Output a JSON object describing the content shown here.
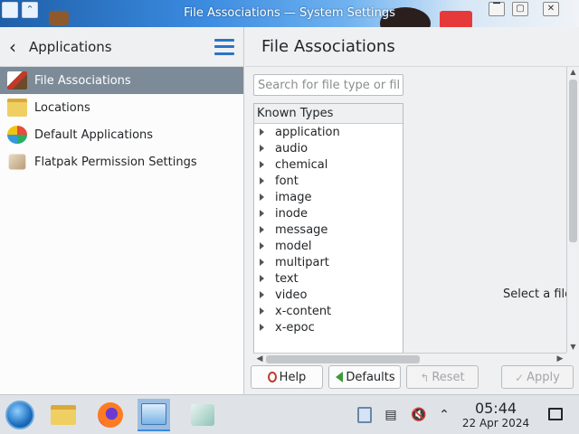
{
  "window": {
    "title": "File Associations — System Settings",
    "buttons": {
      "keep_above": "⌃",
      "minimize": "▔",
      "maximize": "▢",
      "close": "✕"
    }
  },
  "sidebar": {
    "title": "Applications",
    "back_icon": "chevron-left-icon",
    "menu_icon": "hamburger-icon",
    "items": [
      {
        "label": "File Associations",
        "icon": "file-associations-icon",
        "active": true
      },
      {
        "label": "Locations",
        "icon": "folder-icon",
        "active": false
      },
      {
        "label": "Default Applications",
        "icon": "default-apps-icon",
        "active": false
      },
      {
        "label": "Flatpak Permission Settings",
        "icon": "flatpak-icon",
        "active": false
      }
    ]
  },
  "main": {
    "title": "File Associations",
    "search": {
      "placeholder": "Search for file type or fil...",
      "value": ""
    },
    "tree": {
      "header": "Known Types",
      "items": [
        "application",
        "audio",
        "chemical",
        "font",
        "image",
        "inode",
        "message",
        "model",
        "multipart",
        "text",
        "video",
        "x-content",
        "x-epoc"
      ]
    },
    "hint": "Select a file"
  },
  "footer": {
    "help": "Help",
    "defaults": "Defaults",
    "reset": "Reset",
    "apply": "Apply"
  },
  "taskbar": {
    "apps": [
      "start-menu-icon",
      "file-manager-icon",
      "firefox-icon",
      "system-settings-icon",
      "software-store-icon"
    ],
    "tray": [
      "clipboard-icon",
      "notes-icon",
      "volume-muted-icon",
      "expand-tray-icon"
    ],
    "clock": {
      "time": "05:44",
      "date": "22 Apr 2024"
    }
  },
  "colors": {
    "accent": "#3b8be0",
    "active_item_bg": "#7d8b98",
    "window_bg": "#eff0f1"
  }
}
